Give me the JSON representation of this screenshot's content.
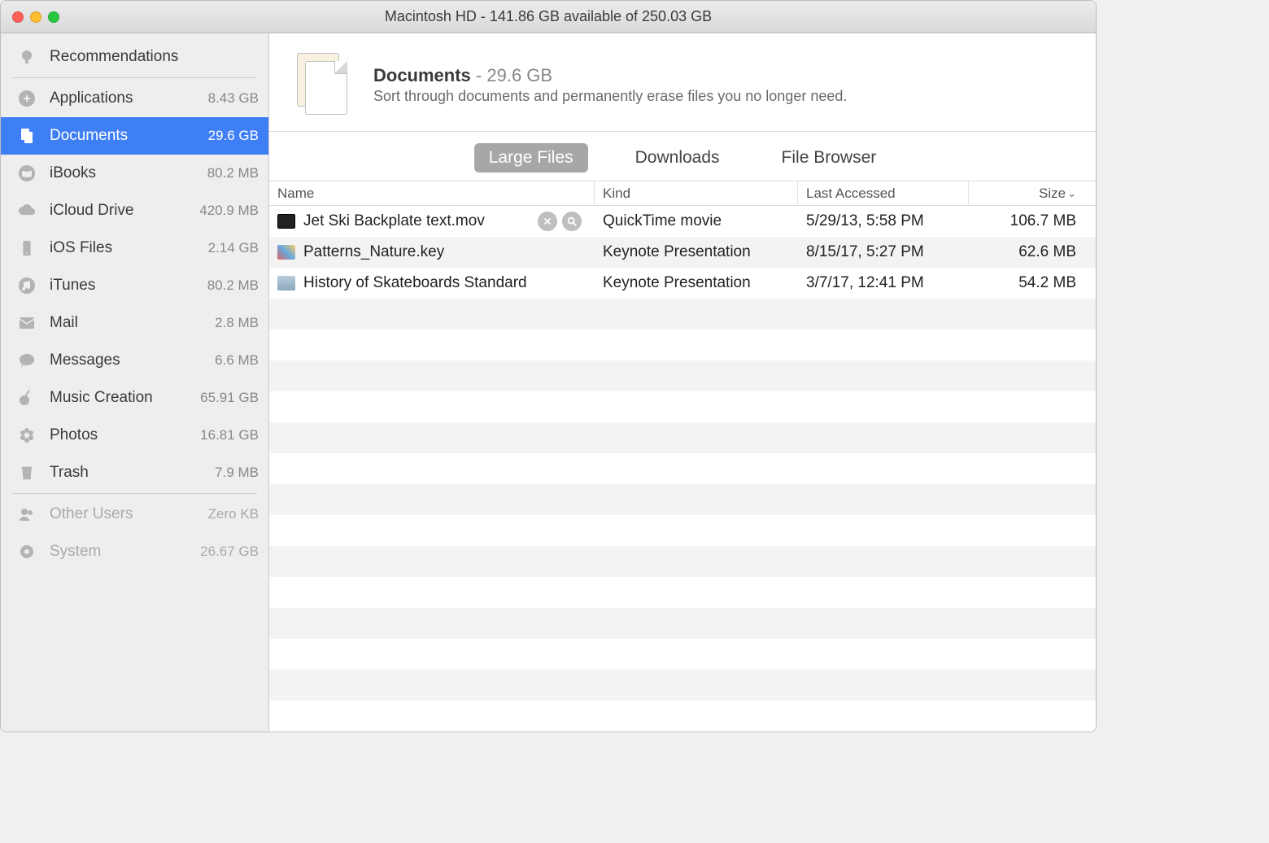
{
  "window": {
    "title": "Macintosh HD - 141.86 GB available of 250.03 GB"
  },
  "sidebar": {
    "recommendations": "Recommendations",
    "items": [
      {
        "label": "Applications",
        "size": "8.43 GB"
      },
      {
        "label": "Documents",
        "size": "29.6 GB"
      },
      {
        "label": "iBooks",
        "size": "80.2 MB"
      },
      {
        "label": "iCloud Drive",
        "size": "420.9 MB"
      },
      {
        "label": "iOS Files",
        "size": "2.14 GB"
      },
      {
        "label": "iTunes",
        "size": "80.2 MB"
      },
      {
        "label": "Mail",
        "size": "2.8 MB"
      },
      {
        "label": "Messages",
        "size": "6.6 MB"
      },
      {
        "label": "Music Creation",
        "size": "65.91 GB"
      },
      {
        "label": "Photos",
        "size": "16.81 GB"
      },
      {
        "label": "Trash",
        "size": "7.9 MB"
      }
    ],
    "other": [
      {
        "label": "Other Users",
        "size": "Zero KB"
      },
      {
        "label": "System",
        "size": "26.67 GB"
      }
    ]
  },
  "header": {
    "title": "Documents",
    "size": "29.6 GB",
    "subtitle": "Sort through documents and permanently erase files you no longer need."
  },
  "tabs": [
    {
      "label": "Large Files"
    },
    {
      "label": "Downloads"
    },
    {
      "label": "File Browser"
    }
  ],
  "table": {
    "columns": {
      "name": "Name",
      "kind": "Kind",
      "date": "Last Accessed",
      "size": "Size"
    },
    "rows": [
      {
        "name": "Jet Ski Backplate text.mov",
        "kind": "QuickTime movie",
        "date": "5/29/13, 5:58 PM",
        "size": "106.7 MB"
      },
      {
        "name": "Patterns_Nature.key",
        "kind": "Keynote Presentation",
        "date": "8/15/17, 5:27 PM",
        "size": "62.6 MB"
      },
      {
        "name": "History of Skateboards Standard",
        "kind": "Keynote Presentation",
        "date": "3/7/17, 12:41 PM",
        "size": "54.2 MB"
      }
    ]
  }
}
